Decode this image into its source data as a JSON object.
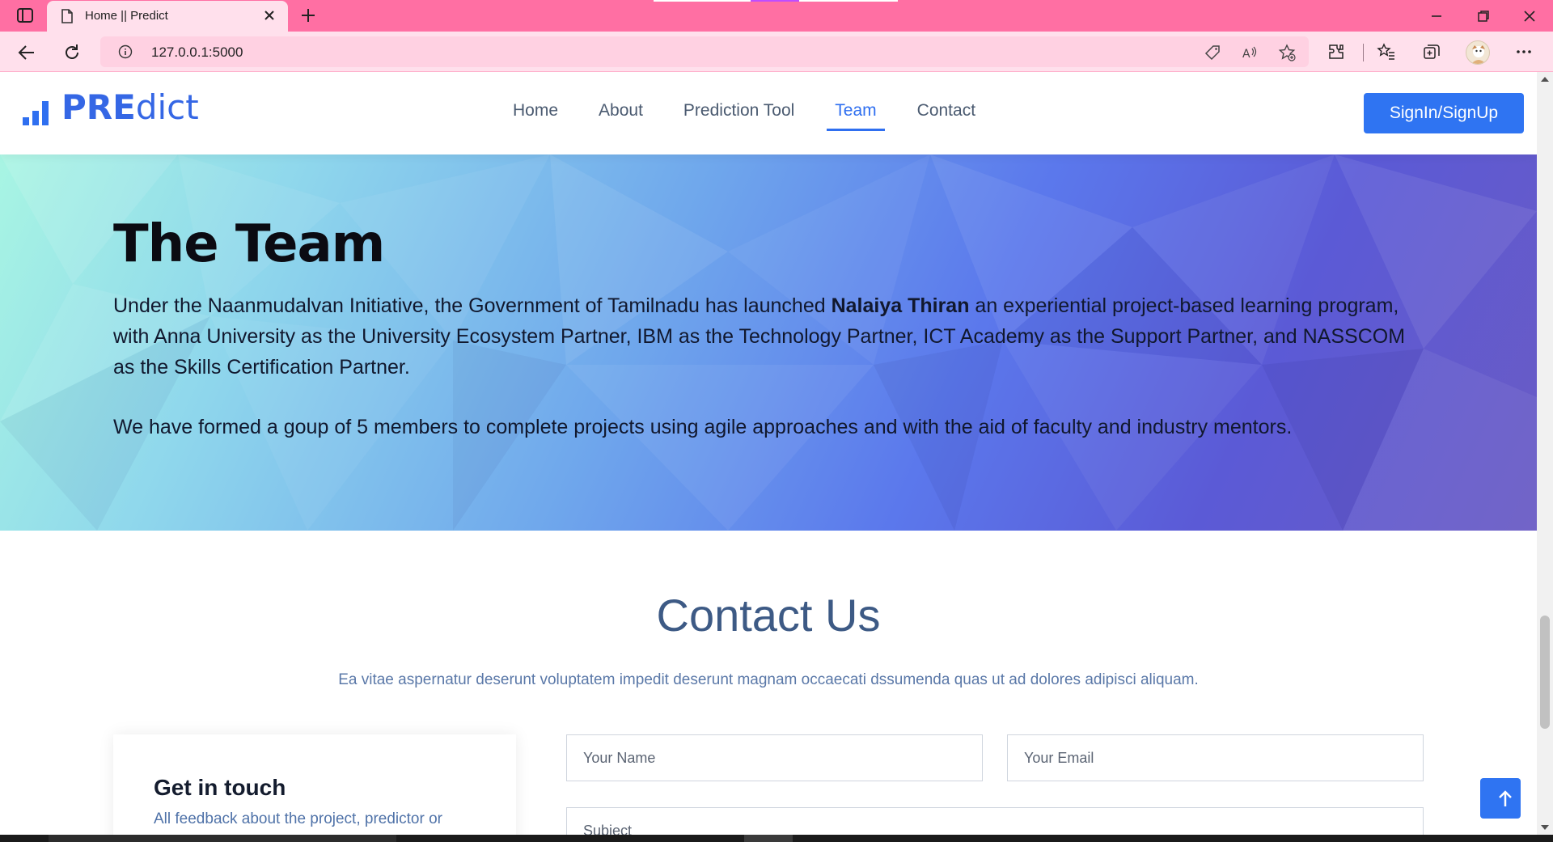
{
  "browser": {
    "tab_title": "Home || Predict",
    "url": "127.0.0.1:5000"
  },
  "header": {
    "logo_bold": "PRE",
    "logo_rest": "dict",
    "nav": [
      "Home",
      "About",
      "Prediction Tool",
      "Team",
      "Contact"
    ],
    "active_nav": "Team",
    "signin_label": "SignIn/SignUp"
  },
  "team": {
    "title": "The Team",
    "paragraph1_before": "Under the Naanmudalvan Initiative, the Government of Tamilnadu has launched ",
    "paragraph1_bold": "Nalaiya Thiran",
    "paragraph1_after": " an experiential project-based learning program, with Anna University as the University Ecosystem Partner, IBM as the Technology Partner, ICT Academy as the Support Partner, and NASSCOM as the Skills Certification Partner.",
    "paragraph2": "We have formed a goup of 5 members to complete projects using agile approaches and with the aid of faculty and industry mentors."
  },
  "contact": {
    "title": "Contact Us",
    "subtitle": "Ea vitae aspernatur deserunt voluptatem impedit deserunt magnam occaecati dssumenda quas ut ad dolores adipisci aliquam.",
    "card_title": "Get in touch",
    "card_text": "All feedback about the project, predictor or",
    "name_placeholder": "Your Name",
    "email_placeholder": "Your Email",
    "subject_placeholder": "Subject"
  },
  "colors": {
    "accent": "#2f74f2",
    "browser_chrome": "#ff6fa3",
    "address_bar": "#ffe0ec"
  }
}
